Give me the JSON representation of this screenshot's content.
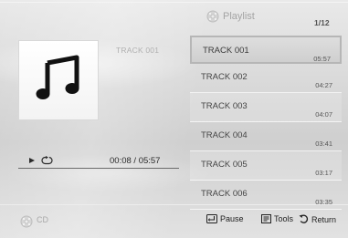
{
  "playlist": {
    "title": "Playlist",
    "count": "1/12",
    "tracks": [
      {
        "title": "TRACK 001",
        "duration": "05:57"
      },
      {
        "title": "TRACK 002",
        "duration": "04:27"
      },
      {
        "title": "TRACK 003",
        "duration": "04:07"
      },
      {
        "title": "TRACK 004",
        "duration": "03:41"
      },
      {
        "title": "TRACK 005",
        "duration": "03:17"
      },
      {
        "title": "TRACK 006",
        "duration": "03:35"
      }
    ],
    "selected_index": 0
  },
  "now_playing": {
    "title": "TRACK 001",
    "time": "00:08 / 05:57",
    "icons": [
      "music-note-icon",
      "play-icon",
      "repeat-icon"
    ]
  },
  "footer": {
    "source_label": "CD",
    "pause_label": "Pause",
    "tools_label": "Tools",
    "return_label": "Return"
  }
}
